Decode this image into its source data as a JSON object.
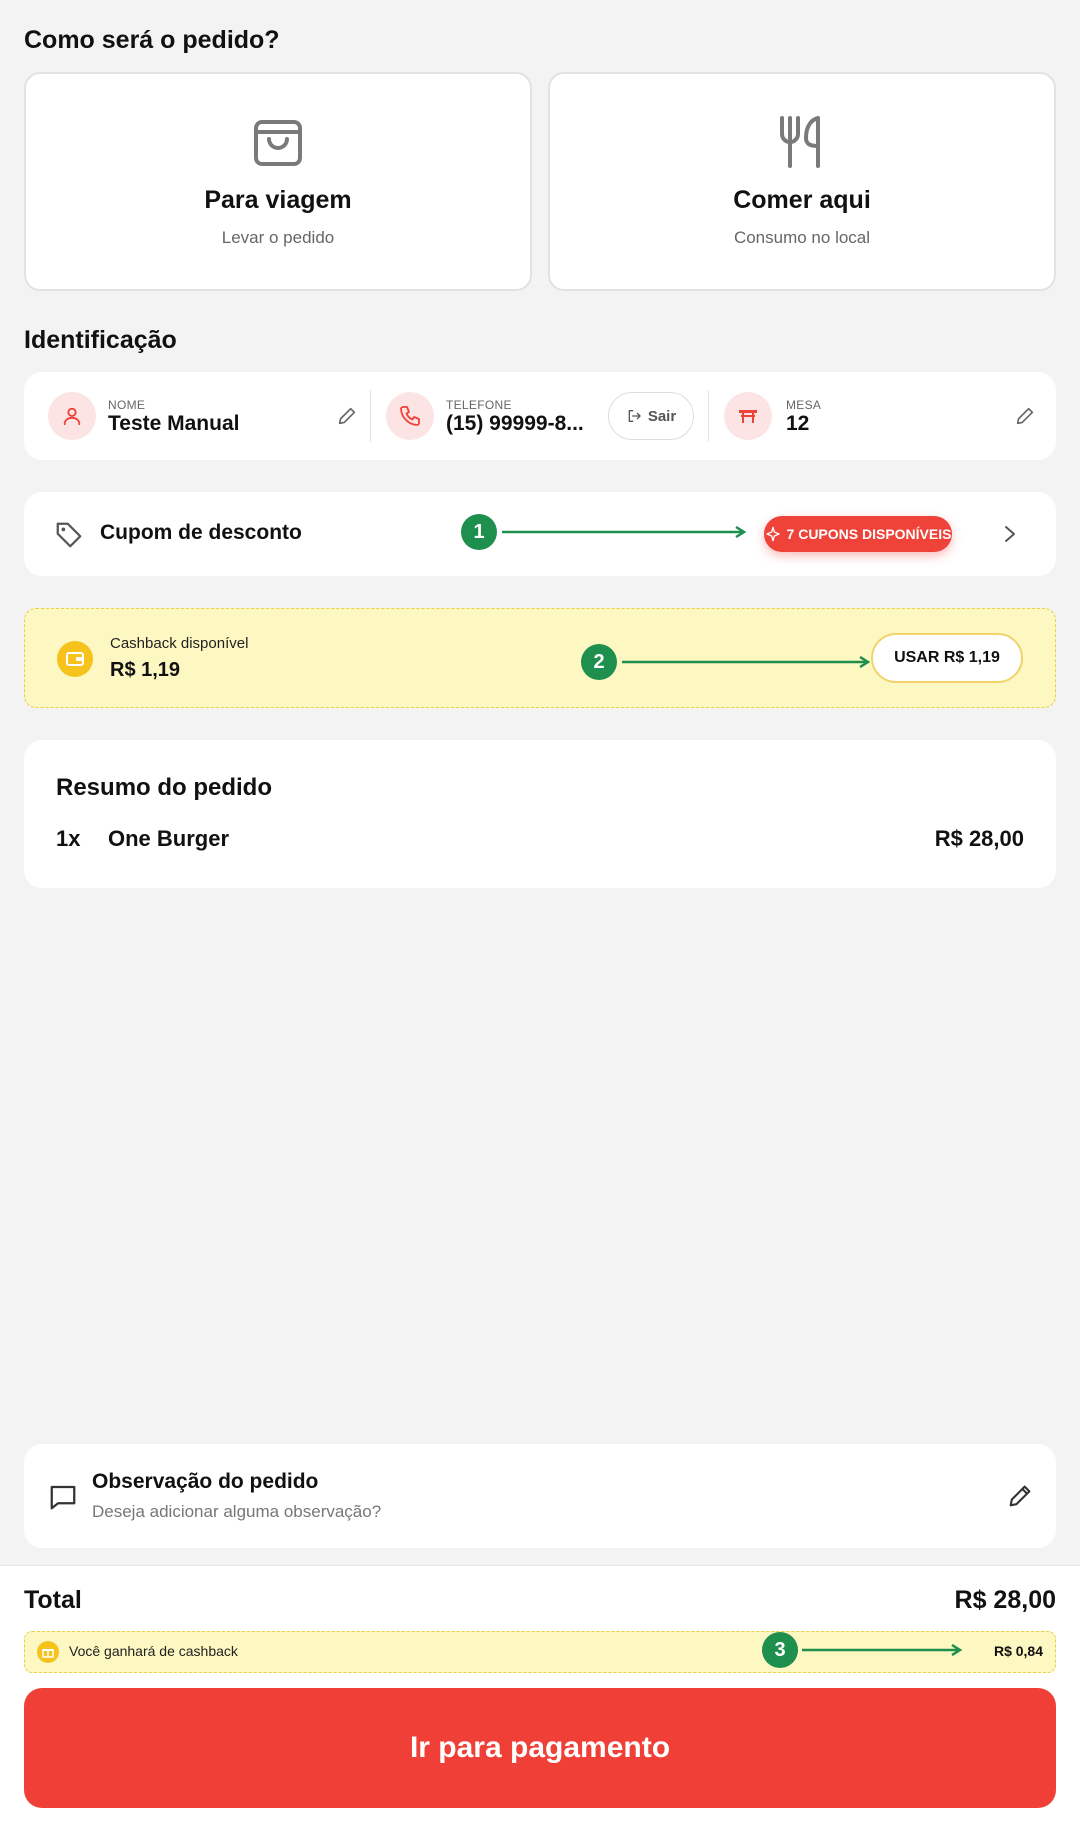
{
  "order_type": {
    "heading": "Como será o pedido?",
    "options": [
      {
        "title": "Para viagem",
        "subtitle": "Levar o pedido",
        "icon": "shopping-bag-icon"
      },
      {
        "title": "Comer aqui",
        "subtitle": "Consumo no local",
        "icon": "fork-knife-icon"
      }
    ]
  },
  "identification": {
    "heading": "Identificação",
    "name": {
      "label": "NOME",
      "value": "Teste Manual"
    },
    "phone": {
      "label": "TELEFONE",
      "value": "(15) 99999-8...",
      "logout_label": "Sair"
    },
    "table": {
      "label": "MESA",
      "value": "12"
    }
  },
  "coupon": {
    "title": "Cupom de desconto",
    "badge": "7 CUPONS DISPONÍVEIS"
  },
  "cashback": {
    "label": "Cashback disponível",
    "value": "R$ 1,19",
    "use_button": "USAR R$ 1,19"
  },
  "summary": {
    "title": "Resumo do pedido",
    "items": [
      {
        "qty": "1x",
        "name": "One Burger",
        "price": "R$ 28,00"
      }
    ]
  },
  "observation": {
    "title": "Observação do pedido",
    "placeholder": "Deseja adicionar alguma observação?"
  },
  "footer": {
    "total_label": "Total",
    "total_value": "R$ 28,00",
    "earn_label": "Você ganhará de cashback",
    "earn_value": "R$ 0,84",
    "pay_button": "Ir para pagamento"
  },
  "annotations": [
    "1",
    "2",
    "3"
  ],
  "colors": {
    "accent_red": "#f03f37",
    "cashback_yellow": "#fdf7c2",
    "coin_yellow": "#f6c21c",
    "annotation_green": "#1f8f4e"
  }
}
